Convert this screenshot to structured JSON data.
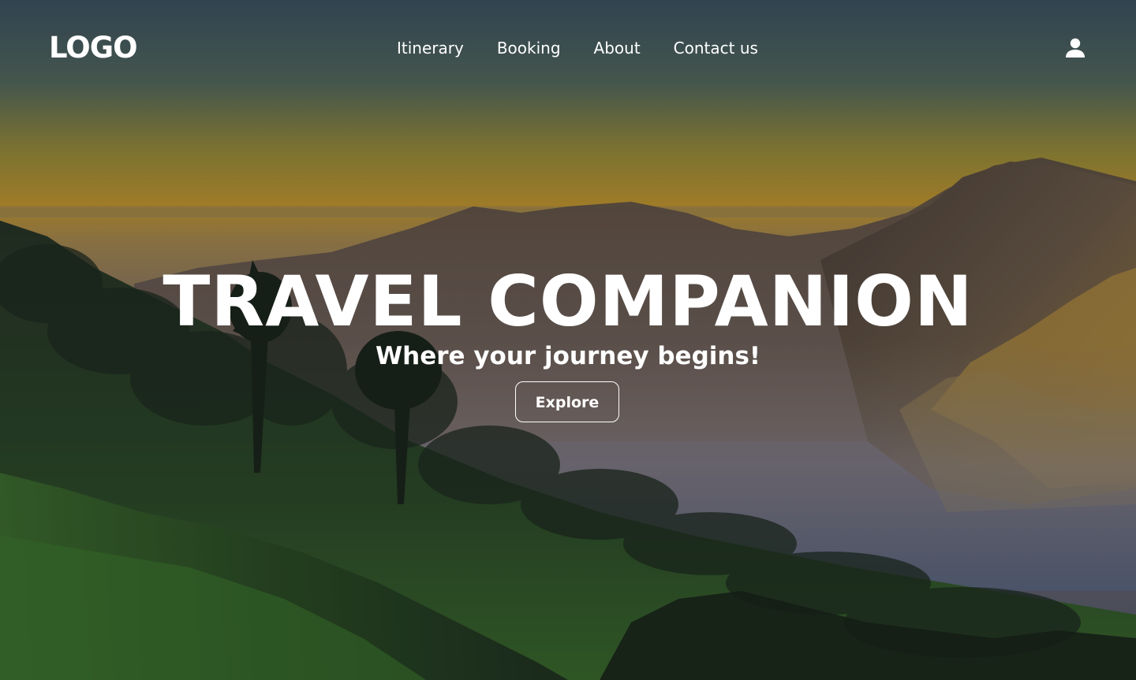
{
  "header": {
    "logo_text": "LOGO",
    "nav": [
      {
        "label": "Itinerary"
      },
      {
        "label": "Booking"
      },
      {
        "label": "About"
      },
      {
        "label": "Contact us"
      }
    ],
    "user_icon": "person-icon"
  },
  "hero": {
    "title": "TRAVEL COMPANION",
    "subtitle": "Where your journey begins!",
    "cta_label": "Explore"
  },
  "theme": {
    "text_color": "#ffffff",
    "sky_top": "#3f5663",
    "sky_horizon": "#d3a237",
    "hill_green": "#2f5f2a"
  }
}
